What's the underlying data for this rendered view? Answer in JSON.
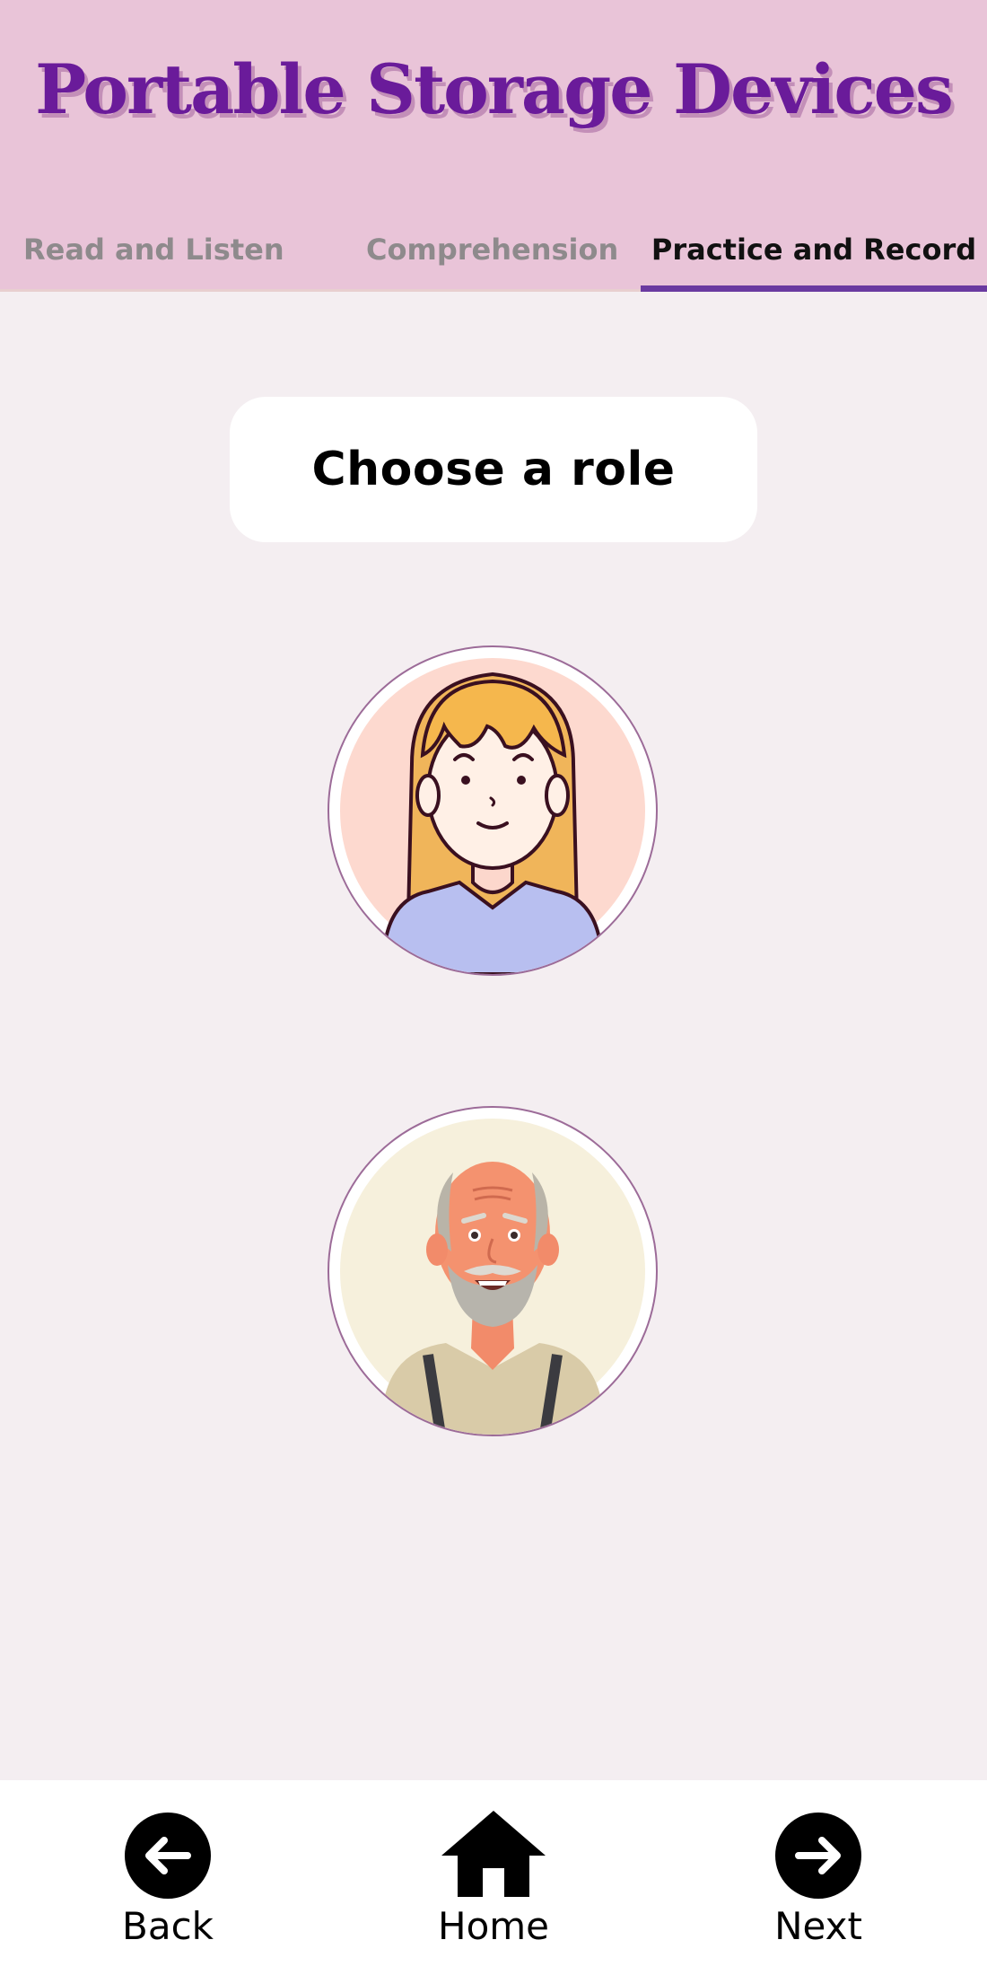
{
  "header": {
    "title": "Portable Storage Devices",
    "tabs": [
      {
        "label": "Read and Listen",
        "active": false
      },
      {
        "label": "Comprehension",
        "active": false
      },
      {
        "label": "Practice and Record",
        "active": true
      }
    ]
  },
  "main": {
    "prompt": "Choose a role",
    "roles": [
      {
        "icon": "girl-avatar-icon"
      },
      {
        "icon": "old-man-avatar-icon"
      }
    ]
  },
  "bottom_nav": {
    "back_label": "Back",
    "home_label": "Home",
    "next_label": "Next"
  },
  "colors": {
    "header_bg": "#e9c4d8",
    "title": "#6a1b9a",
    "active_tab_underline": "#6a3aa0",
    "page_bg": "#f4eef1"
  }
}
